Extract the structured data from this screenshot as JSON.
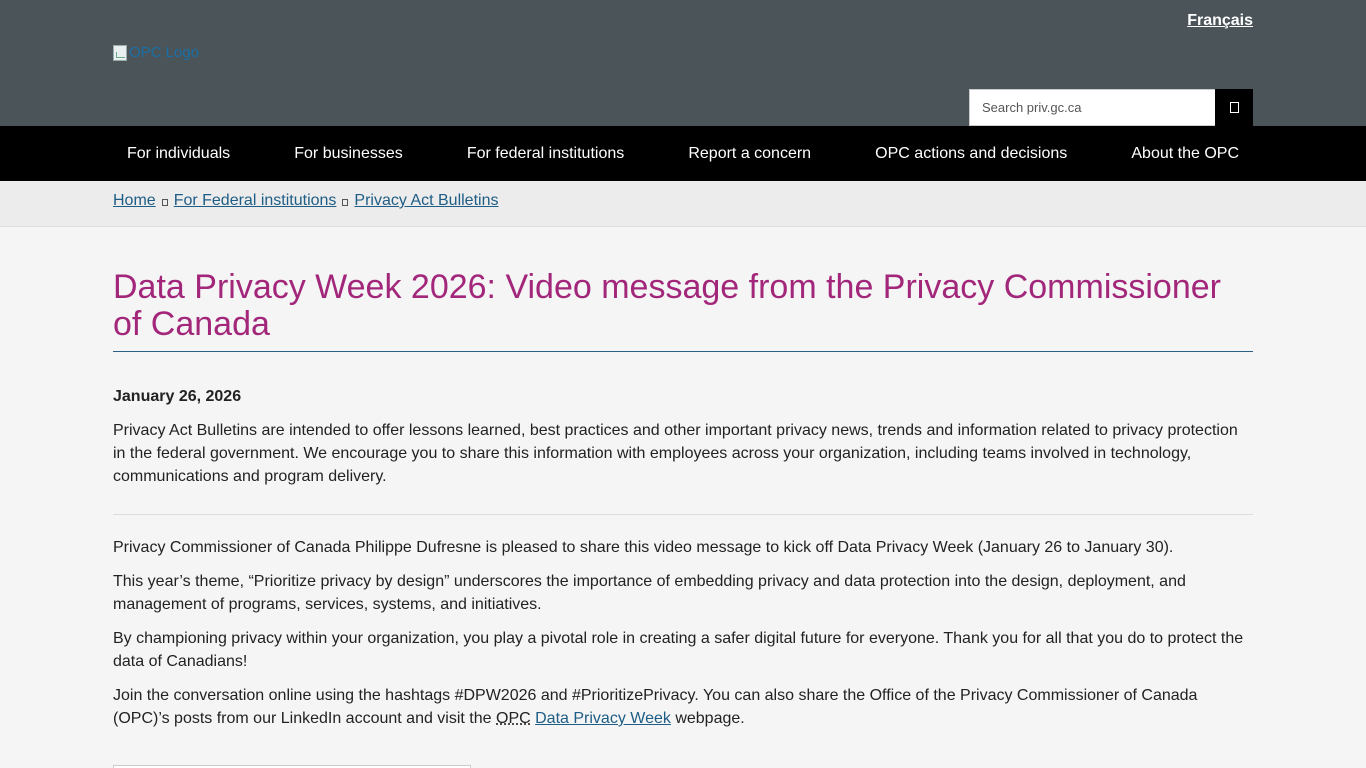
{
  "header": {
    "language_link": "Français",
    "logo_alt": "OPC Logo",
    "search_placeholder": "Search priv.gc.ca"
  },
  "nav": {
    "items": [
      "For individuals",
      "For businesses",
      "For federal institutions",
      "Report a concern",
      "OPC actions and decisions",
      "About the OPC"
    ]
  },
  "breadcrumb": [
    "Home",
    "For Federal institutions",
    "Privacy Act Bulletins"
  ],
  "article": {
    "title": "Data Privacy Week 2026: Video message from the Privacy Commissioner of Canada",
    "date": "January 26, 2026",
    "intro": "Privacy Act Bulletins are intended to offer lessons learned, best practices and other important privacy news, trends and information related to privacy protection in the federal government. We encourage you to share this information with employees across your organization, including teams involved in technology, communications and program delivery.",
    "p1": "Privacy Commissioner of Canada Philippe Dufresne is pleased to share this video message to kick off Data Privacy Week (January 26 to January 30).",
    "p2": "This year’s theme, “Prioritize privacy by design” underscores the importance of embedding privacy and data protection into the design, deployment, and management of programs, services, systems, and initiatives.",
    "p3": "By championing privacy within your organization, you play a pivotal role in creating a safer digital future for everyone. Thank you for all that you do to protect the data of Canadians!",
    "p4_before": "Join the conversation online using the hashtags #DPW2026 and #PrioritizePrivacy. You can also share the Office of the Privacy Commissioner of Canada (OPC)’s posts from our LinkedIn account and visit the ",
    "p4_abbr": "OPC",
    "p4_link": "Data Privacy Week",
    "p4_after": " webpage."
  },
  "colors": {
    "header_bg": "#4a5459",
    "nav_bg": "#000000",
    "title": "#a2277b",
    "link": "#1e5d85"
  }
}
